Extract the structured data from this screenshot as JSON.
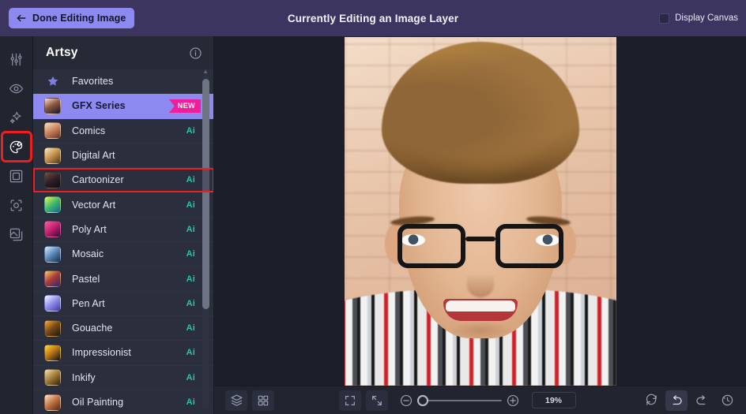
{
  "header": {
    "done_button": "Done Editing Image",
    "back_icon": "arrow-left-icon",
    "title": "Currently Editing an Image Layer",
    "display_canvas_label": "Display Canvas",
    "display_canvas_checked": false,
    "bg_color": "#3b3560",
    "button_color": "#8c8af0"
  },
  "rail": {
    "items": [
      {
        "icon": "adjust-sliders-icon",
        "active": false
      },
      {
        "icon": "eye-icon",
        "active": false
      },
      {
        "icon": "sparkles-icon",
        "active": false
      },
      {
        "icon": "palette-icon",
        "active": true
      },
      {
        "icon": "frame-icon",
        "active": false
      },
      {
        "icon": "crop-focus-icon",
        "active": false
      },
      {
        "icon": "layers-duplicate-icon",
        "active": false
      }
    ],
    "highlight_color": "#f01f1f"
  },
  "panel": {
    "title": "Artsy",
    "info_icon": "info-circle-icon",
    "selected_color": "#8c8af0",
    "ai_badge_color": "#29c6a8",
    "new_badge_color": "#f01e9a",
    "items": [
      {
        "label": "Favorites",
        "icon": "star-icon",
        "badge": "",
        "thumb": "linear-gradient(135deg,#7f7ce8,#5b57c9)",
        "state": "normal"
      },
      {
        "label": "GFX Series",
        "icon": "thumb",
        "badge": "NEW",
        "thumb": "linear-gradient(150deg,#e7c2a8 10%,#8a5a42 45%,#2a2033 90%)",
        "state": "selected"
      },
      {
        "label": "Comics",
        "icon": "thumb",
        "badge": "Ai",
        "thumb": "linear-gradient(150deg,#f2cdae 10%,#c07a55 55%,#6b3d2a 95%)",
        "state": "normal"
      },
      {
        "label": "Digital Art",
        "icon": "thumb",
        "badge": "",
        "thumb": "linear-gradient(140deg,#f5e2b8 5%,#c99a55 45%,#5b4020 95%)",
        "state": "normal"
      },
      {
        "label": "Cartoonizer",
        "icon": "thumb",
        "badge": "Ai",
        "thumb": "linear-gradient(150deg,#6b4a3a 5%,#2d2027 50%,#120d14 95%)",
        "state": "highlighted"
      },
      {
        "label": "Vector Art",
        "icon": "thumb",
        "badge": "Ai",
        "thumb": "linear-gradient(140deg,#d8f05a 5%,#3fb86a 50%,#1d6a9c 95%)",
        "state": "normal"
      },
      {
        "label": "Poly Art",
        "icon": "thumb",
        "badge": "Ai",
        "thumb": "linear-gradient(140deg,#f05a9a 5%,#c01f6b 50%,#3a1040 95%)",
        "state": "normal"
      },
      {
        "label": "Mosaic",
        "icon": "thumb",
        "badge": "Ai",
        "thumb": "linear-gradient(140deg,#cfe3f2 5%,#5a86b8 50%,#1d3552 95%)",
        "state": "normal"
      },
      {
        "label": "Pastel",
        "icon": "thumb",
        "badge": "Ai",
        "thumb": "linear-gradient(140deg,#f0c060 5%,#a83a3a 48%,#3a2a6a 95%)",
        "state": "normal"
      },
      {
        "label": "Pen Art",
        "icon": "thumb",
        "badge": "Ai",
        "thumb": "linear-gradient(140deg,#eef0ff 5%,#8d8ce8 50%,#4a3ea8 95%)",
        "state": "normal"
      },
      {
        "label": "Gouache",
        "icon": "thumb",
        "badge": "Ai",
        "thumb": "linear-gradient(140deg,#f0a030 5%,#7a4a18 48%,#18200f 95%)",
        "state": "normal"
      },
      {
        "label": "Impressionist",
        "icon": "thumb",
        "badge": "Ai",
        "thumb": "linear-gradient(140deg,#f5d23a 5%,#c07a18 45%,#1a1a18 95%)",
        "state": "normal"
      },
      {
        "label": "Inkify",
        "icon": "thumb",
        "badge": "Ai",
        "thumb": "linear-gradient(140deg,#e8d8a8 5%,#a07a38 50%,#3a2a12 95%)",
        "state": "normal"
      },
      {
        "label": "Oil Painting",
        "icon": "thumb",
        "badge": "Ai",
        "thumb": "linear-gradient(140deg,#f0dcc0 5%,#c07040 50%,#5a3020 95%)",
        "state": "normal"
      }
    ]
  },
  "canvas": {
    "image_description": "Portrait photo of a young man with curly brown hair wearing black-framed glasses and a red, white and black plaid shirt, standing in front of a blurred brick wall",
    "background_color": "#1c1e2a"
  },
  "bottombar": {
    "left_tools": [
      {
        "icon": "layers-icon"
      },
      {
        "icon": "grid-icon"
      }
    ],
    "center_tools": [
      {
        "icon": "fullscreen-icon"
      },
      {
        "icon": "fit-to-screen-icon"
      }
    ],
    "zoom_out_icon": "zoom-out-icon",
    "zoom_in_icon": "zoom-in-icon",
    "zoom_value": "19%",
    "slider_position_percent": 0,
    "right_tools": [
      {
        "icon": "reset-icon",
        "active": false
      },
      {
        "icon": "undo-icon",
        "active": true
      },
      {
        "icon": "redo-icon",
        "active": false
      },
      {
        "icon": "history-icon",
        "active": false
      }
    ]
  }
}
